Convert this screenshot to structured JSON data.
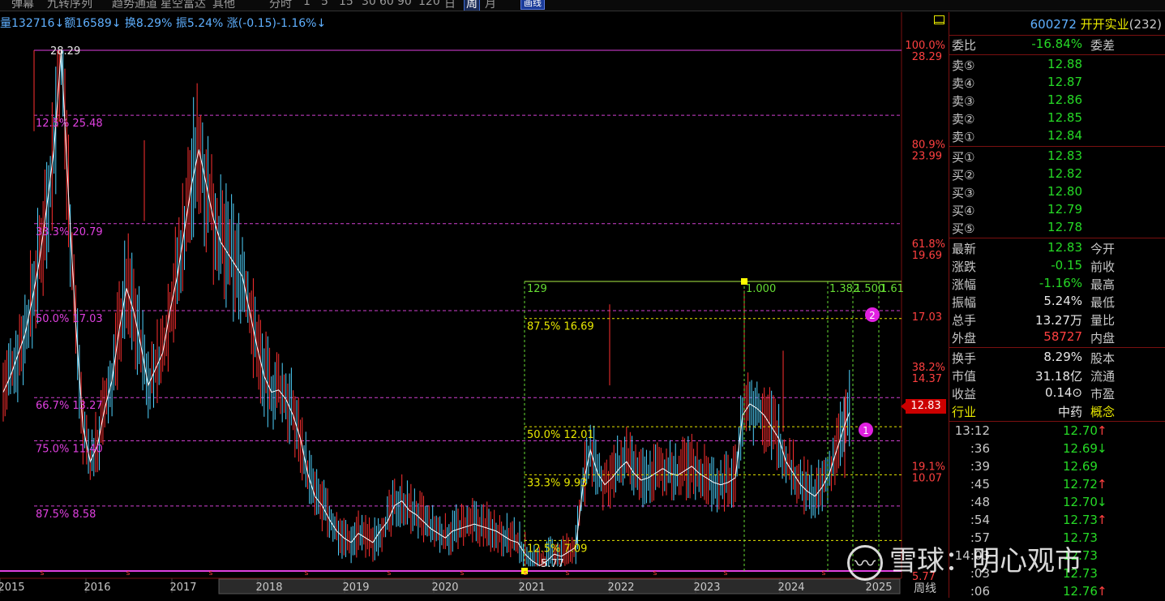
{
  "toolbar": {
    "items": [
      "弹幕",
      "九转序列",
      "趋势通道",
      "星空富达",
      "其他",
      "分时",
      "1",
      "5",
      "15",
      "30",
      "60",
      "90",
      "120",
      "日",
      "周",
      "月"
    ],
    "active": "周",
    "draw_button": "画线"
  },
  "info_bar": {
    "volume": "量132716↓",
    "amount": "额16589↓",
    "turnover": "换8.29%",
    "amplitude": "振5.24%",
    "change": "涨(-0.15)-1.16%↓"
  },
  "chart": {
    "top_price_label": "28.29",
    "low_price_label": "5.77",
    "bottom_right_label": "5.77",
    "left_fib_labels": [
      {
        "text": "12.5% 25.48",
        "price": 25.48
      },
      {
        "text": "33.3% 20.79",
        "price": 20.79
      },
      {
        "text": "50.0% 17.03",
        "price": 17.03
      },
      {
        "text": "66.7% 13.27",
        "price": 13.27
      },
      {
        "text": "75.0% 11.40",
        "price": 11.4
      },
      {
        "text": "87.5% 8.58",
        "price": 8.58
      }
    ],
    "right_axis": [
      {
        "pct": "100.0%",
        "price": "28.29",
        "v": 28.29
      },
      {
        "pct": "80.9%",
        "price": "23.99",
        "v": 23.99
      },
      {
        "pct": "61.8%",
        "price": "19.69",
        "v": 19.69
      },
      {
        "pct": "",
        "price": "17.03",
        "v": 17.03
      },
      {
        "pct": "38.2%",
        "price": "14.37",
        "v": 14.37
      },
      {
        "pct": "19.1%",
        "price": "10.07",
        "v": 10.07
      }
    ],
    "current_price_badge": "12.83",
    "box": {
      "top_label": "129",
      "fib_labels": [
        {
          "text": "87.5% 16.69",
          "price": 16.69
        },
        {
          "text": "50.0% 12.01",
          "price": 12.01
        },
        {
          "text": "33.3% 9.93",
          "price": 9.93
        },
        {
          "text": "12.5% 7.09",
          "price": 7.09
        }
      ],
      "time_labels": [
        "1.000",
        "1.382",
        "1.500",
        "1.61"
      ]
    },
    "markers": [
      "1",
      "2"
    ],
    "years": [
      "2015",
      "2016",
      "2017",
      "2018",
      "2019",
      "2020",
      "2021",
      "2022",
      "2023",
      "2024",
      "2025"
    ],
    "period_label": "周线"
  },
  "chart_data": {
    "type": "candlestick",
    "x_axis_years": [
      "2015",
      "2016",
      "2017",
      "2018",
      "2019",
      "2020",
      "2021",
      "2022",
      "2023",
      "2024",
      "2025"
    ],
    "ylim": [
      5.77,
      28.29
    ],
    "high": 28.29,
    "low": 5.77,
    "last": 12.83,
    "fib_levels_left": [
      25.48,
      20.79,
      17.03,
      13.27,
      11.4,
      8.58
    ],
    "fib_levels_box": [
      16.69,
      12.01,
      9.93,
      7.09
    ],
    "series": [
      {
        "name": "close",
        "values": [
          13.5,
          14.2,
          15.1,
          16.0,
          17.5,
          19.2,
          21.5,
          24.0,
          28.29,
          22.0,
          16.5,
          12.0,
          10.5,
          11.2,
          12.8,
          14.0,
          16.2,
          18.0,
          17.0,
          15.5,
          13.8,
          14.5,
          15.2,
          17.0,
          18.5,
          20.5,
          22.5,
          24.0,
          22.5,
          21.0,
          20.0,
          19.5,
          19.0,
          18.5,
          17.0,
          15.5,
          14.2,
          13.5,
          13.6,
          13.2,
          12.5,
          11.5,
          10.0,
          9.0,
          8.6,
          8.0,
          7.5,
          7.2,
          7.0,
          7.4,
          7.2,
          7.0,
          7.5,
          7.9,
          8.6,
          8.8,
          8.4,
          8.2,
          7.9,
          7.6,
          7.4,
          7.2,
          7.5,
          7.6,
          7.7,
          7.8,
          7.7,
          7.6,
          7.5,
          7.3,
          7.1,
          7.0,
          6.5,
          6.2,
          6.0,
          6.2,
          6.5,
          6.4,
          6.6,
          6.8,
          9.5,
          11.0,
          10.0,
          9.5,
          9.8,
          10.2,
          10.5,
          10.0,
          9.7,
          9.8,
          10.0,
          10.2,
          10.0,
          9.9,
          10.1,
          10.3,
          10.0,
          9.8,
          9.6,
          9.5,
          9.6,
          9.8,
          12.5,
          13.0,
          12.8,
          12.5,
          12.0,
          11.5,
          10.5,
          10.0,
          9.5,
          9.2,
          9.0,
          9.4,
          10.0,
          11.0,
          12.0,
          12.83
        ]
      }
    ]
  },
  "quote_panel": {
    "code": "600272",
    "name": "开开实业",
    "count": "(232)",
    "weibi": {
      "label": "委比",
      "value": "-16.84%",
      "label2": "委差"
    },
    "sells": [
      {
        "label": "卖⑤",
        "price": "12.88"
      },
      {
        "label": "卖④",
        "price": "12.87"
      },
      {
        "label": "卖③",
        "price": "12.86"
      },
      {
        "label": "卖②",
        "price": "12.85"
      },
      {
        "label": "卖①",
        "price": "12.84"
      }
    ],
    "buys": [
      {
        "label": "买①",
        "price": "12.83"
      },
      {
        "label": "买②",
        "price": "12.82"
      },
      {
        "label": "买③",
        "price": "12.80"
      },
      {
        "label": "买④",
        "price": "12.79"
      },
      {
        "label": "买⑤",
        "price": "12.78"
      }
    ],
    "stats": [
      {
        "label": "最新",
        "value": "12.83",
        "label2": "今开",
        "color": "green"
      },
      {
        "label": "涨跌",
        "value": "-0.15",
        "label2": "前收",
        "color": "green"
      },
      {
        "label": "涨幅",
        "value": "-1.16%",
        "label2": "最高",
        "color": "green"
      },
      {
        "label": "振幅",
        "value": "5.24%",
        "label2": "最低",
        "color": "white"
      },
      {
        "label": "总手",
        "value": "13.27万",
        "label2": "量比",
        "color": "white"
      },
      {
        "label": "外盘",
        "value": "58727",
        "label2": "内盘",
        "color": "red"
      }
    ],
    "stats2": [
      {
        "label": "换手",
        "value": "8.29%",
        "label2": "股本",
        "color": "white"
      },
      {
        "label": "市值",
        "value": "31.18亿",
        "label2": "流通",
        "color": "white"
      },
      {
        "label": "收益",
        "value": "0.14⊙",
        "label2": "市盈",
        "color": "white"
      }
    ],
    "industry": {
      "label": "行业",
      "value": "中药",
      "label2": "概念"
    },
    "ticks": [
      {
        "time": "13:12",
        "price": "12.70",
        "arrow": "↑"
      },
      {
        "time": ":36",
        "price": "12.69",
        "arrow": "↓"
      },
      {
        "time": ":39",
        "price": "12.69",
        "arrow": ""
      },
      {
        "time": ":45",
        "price": "12.72",
        "arrow": "↑"
      },
      {
        "time": ":48",
        "price": "12.70",
        "arrow": "↓"
      },
      {
        "time": ":54",
        "price": "12.73",
        "arrow": "↑"
      },
      {
        "time": ":57",
        "price": "12.73",
        "arrow": ""
      },
      {
        "time": "14:03",
        "price": "12.73",
        "arrow": ""
      },
      {
        "time": ":03",
        "price": "12.73",
        "arrow": ""
      },
      {
        "time": ":06",
        "price": "12.76",
        "arrow": "↑"
      }
    ]
  },
  "watermark": {
    "text": "雪球：明心观市"
  }
}
